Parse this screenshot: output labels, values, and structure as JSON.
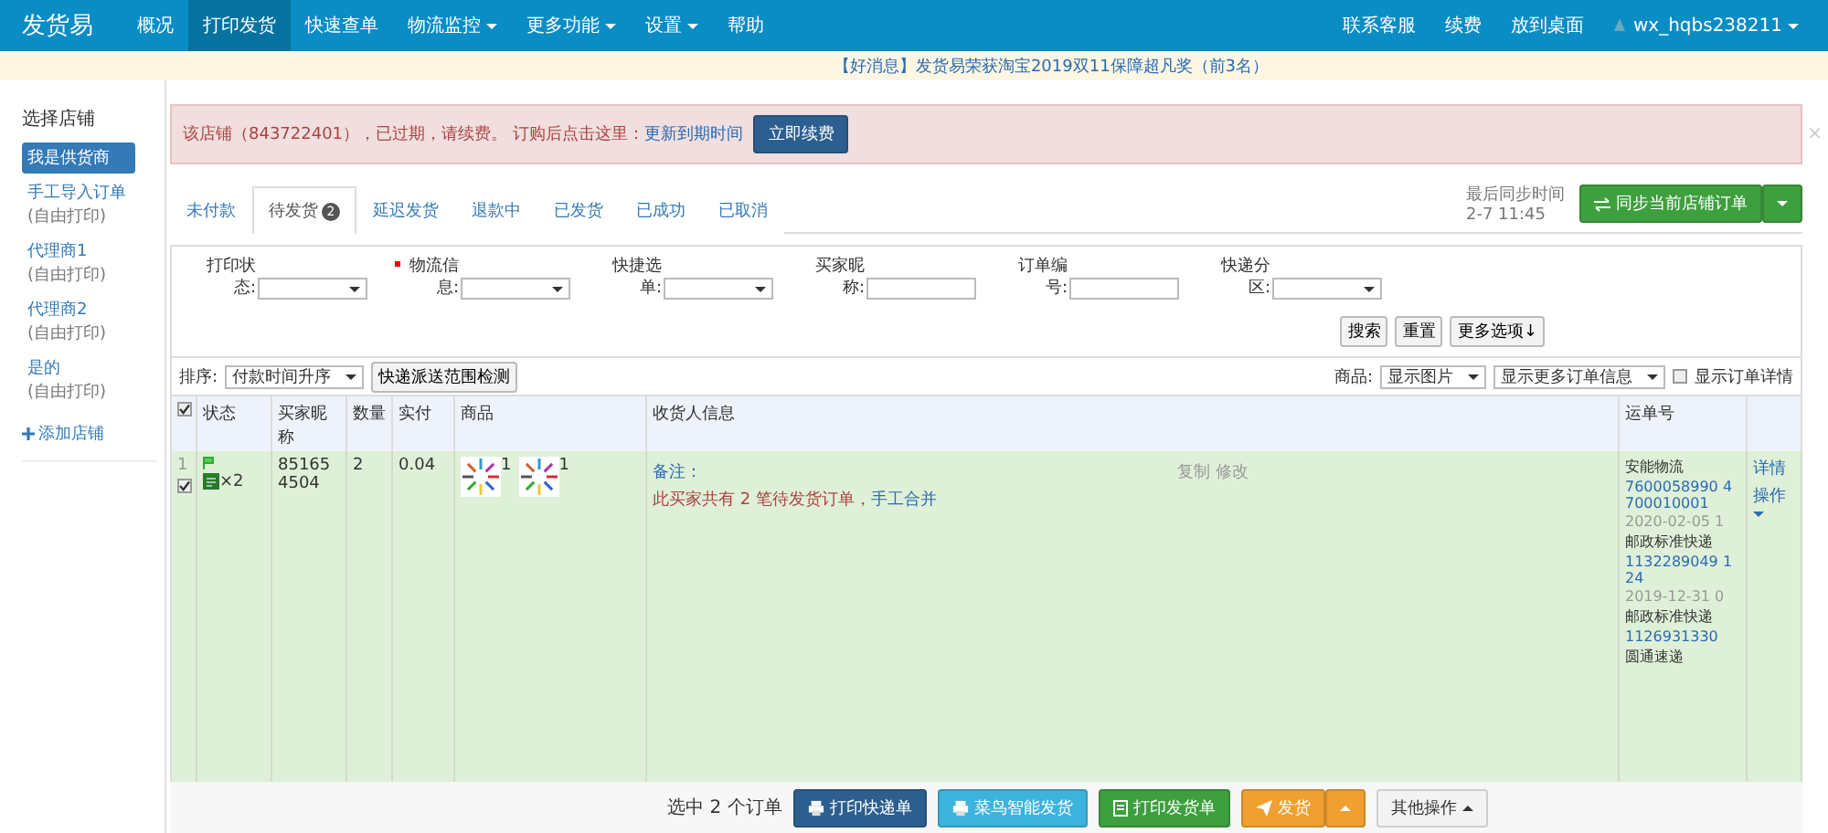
{
  "navbar": {
    "brand": "发货易",
    "items": [
      {
        "label": "概况",
        "selected": false,
        "dropdown": false
      },
      {
        "label": "打印发货",
        "selected": true,
        "dropdown": false
      },
      {
        "label": "快速查单",
        "selected": false,
        "dropdown": false
      },
      {
        "label": "物流监控",
        "selected": false,
        "dropdown": true
      },
      {
        "label": "更多功能",
        "selected": false,
        "dropdown": true
      },
      {
        "label": "设置",
        "selected": false,
        "dropdown": true
      },
      {
        "label": "帮助",
        "selected": false,
        "dropdown": false
      }
    ],
    "right_items": [
      "联系客服",
      "续费",
      "放到桌面"
    ],
    "user": "wx_hqbs238211"
  },
  "notice": "【好消息】发货易荣获淘宝2019双11保障超凡奖（前3名）",
  "sidebar": {
    "title": "选择店铺",
    "shops": [
      {
        "name": "我是供货商",
        "selected": true
      },
      {
        "name": "手工导入订单",
        "note": "(自由打印)",
        "selected": false
      },
      {
        "name": "代理商1",
        "note": "(自由打印)",
        "selected": false
      },
      {
        "name": "代理商2",
        "note": "(自由打印)",
        "selected": false
      },
      {
        "name": "是的",
        "note": "(自由打印)",
        "selected": false
      }
    ],
    "add": "添加店铺"
  },
  "alert": {
    "text": "该店铺（843722401），已过期，请续费。 订购后点击这里：",
    "link": "更新到期时间",
    "button": "立即续费",
    "close": "×"
  },
  "tabs": [
    {
      "label": "未付款",
      "selected": false
    },
    {
      "label": "待发货",
      "badge": "2",
      "selected": true
    },
    {
      "label": "延迟发货",
      "selected": false
    },
    {
      "label": "退款中",
      "selected": false
    },
    {
      "label": "已发货",
      "selected": false
    },
    {
      "label": "已成功",
      "selected": false
    },
    {
      "label": "已取消",
      "selected": false
    }
  ],
  "sync": {
    "label": "最后同步时间",
    "time": "2-7 11:45",
    "button": "同步当前店铺订单"
  },
  "filters": [
    {
      "kind": "select",
      "l1": "打印状",
      "l2": "态:",
      "required": false
    },
    {
      "kind": "select",
      "l1": "物流信",
      "l2": "息:",
      "required": true
    },
    {
      "kind": "select",
      "l1": "快捷选",
      "l2": "单:",
      "required": false
    },
    {
      "kind": "input",
      "l1": "买家昵",
      "l2": "称:",
      "required": false
    },
    {
      "kind": "input",
      "l1": "订单编",
      "l2": "号:",
      "required": false
    },
    {
      "kind": "select",
      "l1": "快递分",
      "l2": "区:",
      "required": false
    }
  ],
  "filter_buttons": [
    "搜索",
    "重置",
    "更多选项↓"
  ],
  "sort": {
    "label": "排序:",
    "value": "付款时间升序",
    "check_button": "快递派送范围检测",
    "goods_label": "商品:",
    "goods_value": "显示图片",
    "more_info": "显示更多订单信息",
    "detail_label": "显示订单详情",
    "detail_checked": false
  },
  "table": {
    "all_checked": true,
    "columns": [
      "状态",
      "买家昵称",
      "数量",
      "实付",
      "商品",
      "收货人信息",
      "运单号"
    ],
    "rows": [
      {
        "index": "1",
        "checked": true,
        "count": "×2",
        "buyer": "851654504",
        "qty": "2",
        "paid": "0.04",
        "goods": [
          {
            "count": "1"
          },
          {
            "count": "1"
          }
        ],
        "remark_label": "备注：",
        "actions": [
          "复制",
          "修改"
        ],
        "message": "此买家共有 2 笔待发货订单，",
        "merge_link": "手工合并",
        "waybills": [
          {
            "carrier": "安能物流",
            "number": "7600058990 4700010001",
            "date": "2020-02-05 1"
          },
          {
            "carrier": "邮政标准快递",
            "number": "1132289049 124",
            "date": "2019-12-31 0"
          },
          {
            "carrier": "邮政标准快递",
            "number": "1126931330"
          },
          {
            "carrier": "圆通速递"
          }
        ],
        "ops": [
          "详情",
          "操作"
        ]
      }
    ]
  },
  "footer": {
    "selected_text": "选中 2 个订单",
    "buttons": [
      {
        "label": "打印快递单",
        "kind": "primary"
      },
      {
        "label": "菜鸟智能发货",
        "kind": "info"
      },
      {
        "label": "打印发货单",
        "kind": "success"
      },
      {
        "label": "发货",
        "kind": "warning"
      },
      {
        "label": "其他操作",
        "kind": "default"
      }
    ]
  }
}
